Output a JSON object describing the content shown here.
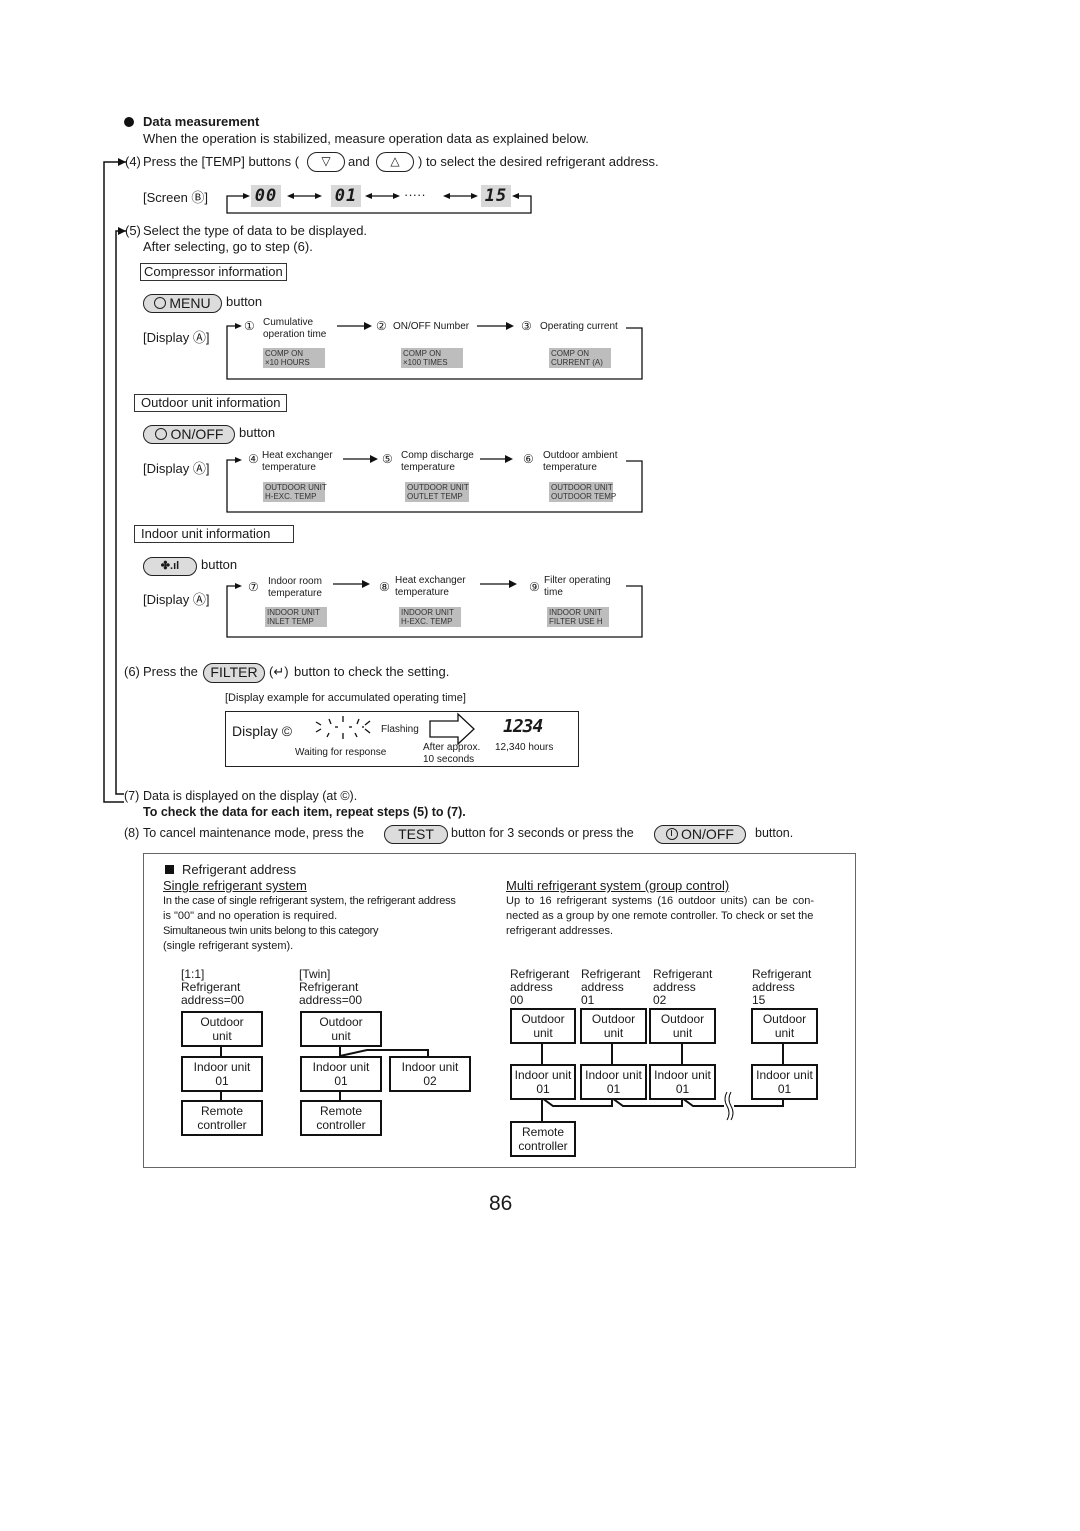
{
  "section": {
    "title": "Data measurement",
    "intro": "When the operation is stabilized, measure operation data as explained below."
  },
  "step4": {
    "num": "(4)",
    "text_before": "Press the [TEMP] buttons (",
    "btn_down": "▽",
    "and": "and",
    "btn_up": "△",
    "text_after": ") to select the desired refrigerant address.",
    "screen_label": "[Screen Ⓑ]",
    "addresses": [
      "00",
      "01",
      "15"
    ],
    "ellipsis": "·····"
  },
  "step5": {
    "num": "(5)",
    "line1": "Select the type of data to be displayed.",
    "line2": "After selecting, go to step (6)."
  },
  "groups": [
    {
      "title": "Compressor information",
      "button": "MENU",
      "button_icon": "clock-icon",
      "button_suffix": "button",
      "display_label": "[Display Ⓐ]",
      "items": [
        {
          "num": "①",
          "label1": "Cumulative",
          "label2": "operation time",
          "lcd": "COMP ON\n×10 HOURS"
        },
        {
          "num": "②",
          "label1": "ON/OFF Number",
          "label2": "",
          "lcd": "COMP ON\n×100 TIMES"
        },
        {
          "num": "③",
          "label1": "Operating current",
          "label2": "",
          "lcd": "COMP ON\nCURRENT (A)"
        }
      ]
    },
    {
      "title": "Outdoor unit information",
      "button": "ON/OFF",
      "button_icon": "clock-icon",
      "button_suffix": "button",
      "display_label": "[Display Ⓐ]",
      "items": [
        {
          "num": "④",
          "label1": "Heat exchanger",
          "label2": "temperature",
          "lcd": "OUTDOOR UNIT\nH-EXC. TEMP"
        },
        {
          "num": "⑤",
          "label1": "Comp discharge",
          "label2": "temperature",
          "lcd": "OUTDOOR UNIT\nOUTLET TEMP"
        },
        {
          "num": "⑥",
          "label1": "Outdoor ambient",
          "label2": "temperature",
          "lcd": "OUTDOOR UNIT\nOUTDOOR TEMP"
        }
      ]
    },
    {
      "title": "Indoor unit information",
      "button": "✤.ıl",
      "button_icon": "fan-speed-icon",
      "button_suffix": "button",
      "display_label": "[Display Ⓐ]",
      "items": [
        {
          "num": "⑦",
          "label1": "Indoor room",
          "label2": "temperature",
          "lcd": "INDOOR UNIT\nINLET TEMP"
        },
        {
          "num": "⑧",
          "label1": "Heat exchanger",
          "label2": "temperature",
          "lcd": "INDOOR UNIT\nH-EXC. TEMP"
        },
        {
          "num": "⑨",
          "label1": "Filter operating",
          "label2": "time",
          "lcd": "INDOOR UNIT\nFILTER USE H"
        }
      ]
    }
  ],
  "step6": {
    "num": "(6)",
    "text_before": "Press the",
    "button": "FILTER",
    "enter_symbol": "(↵)",
    "text_after": "button to check the setting.",
    "example_caption": "[Display example for accumulated operating time]",
    "display_label": "Display ©",
    "flashing": "Flashing",
    "waiting": "Waiting for response",
    "after1": "After approx.",
    "after2": "10 seconds",
    "value": "1234",
    "value_caption": "12,340 hours"
  },
  "step7": {
    "num": "(7)",
    "text": "Data is displayed on the display (at ©).",
    "bold": "To check the data for each item, repeat steps (5) to (7)."
  },
  "step8": {
    "num": "(8)",
    "text_before": "To cancel maintenance mode, press the",
    "test_button": "TEST",
    "text_middle": "button for 3 seconds or press the",
    "onoff_button": "ON/OFF",
    "onoff_icon": "power-icon",
    "text_after": "button."
  },
  "refbox": {
    "title": "Refrigerant address",
    "single": {
      "heading": "Single refrigerant system",
      "lines": [
        "In the case of single refrigerant system, the refrigerant address",
        "is \"00\" and no operation is required.",
        "Simultaneous twin units belong to this category",
        "(single refrigerant system)."
      ]
    },
    "multi": {
      "heading": "Multi refrigerant system (group control)",
      "lines": [
        "Up to 16 refrigerant systems (16 outdoor units) can be con-",
        "nected as a group by one remote controller. To check or set the",
        "refrigerant addresses."
      ]
    },
    "diagrams": {
      "one_to_one": {
        "l1": "[1:1]",
        "l2": "Refrigerant",
        "l3": "address=00"
      },
      "twin": {
        "l1": "[Twin]",
        "l2": "Refrigerant",
        "l3": "address=00"
      },
      "outdoor1": "Outdoor",
      "outdoor2": "unit",
      "indoor": "Indoor unit",
      "remote1": "Remote",
      "remote2": "controller",
      "idx01": "01",
      "idx02": "02",
      "multi_heads": [
        {
          "l1": "Refrigerant",
          "l2": "address",
          "l3": "00"
        },
        {
          "l1": "Refrigerant",
          "l2": "address",
          "l3": "01"
        },
        {
          "l1": "Refrigerant",
          "l2": "address",
          "l3": "02"
        },
        {
          "l1": "Refrigerant",
          "l2": "address",
          "l3": "15"
        }
      ]
    }
  },
  "page_number": "86"
}
